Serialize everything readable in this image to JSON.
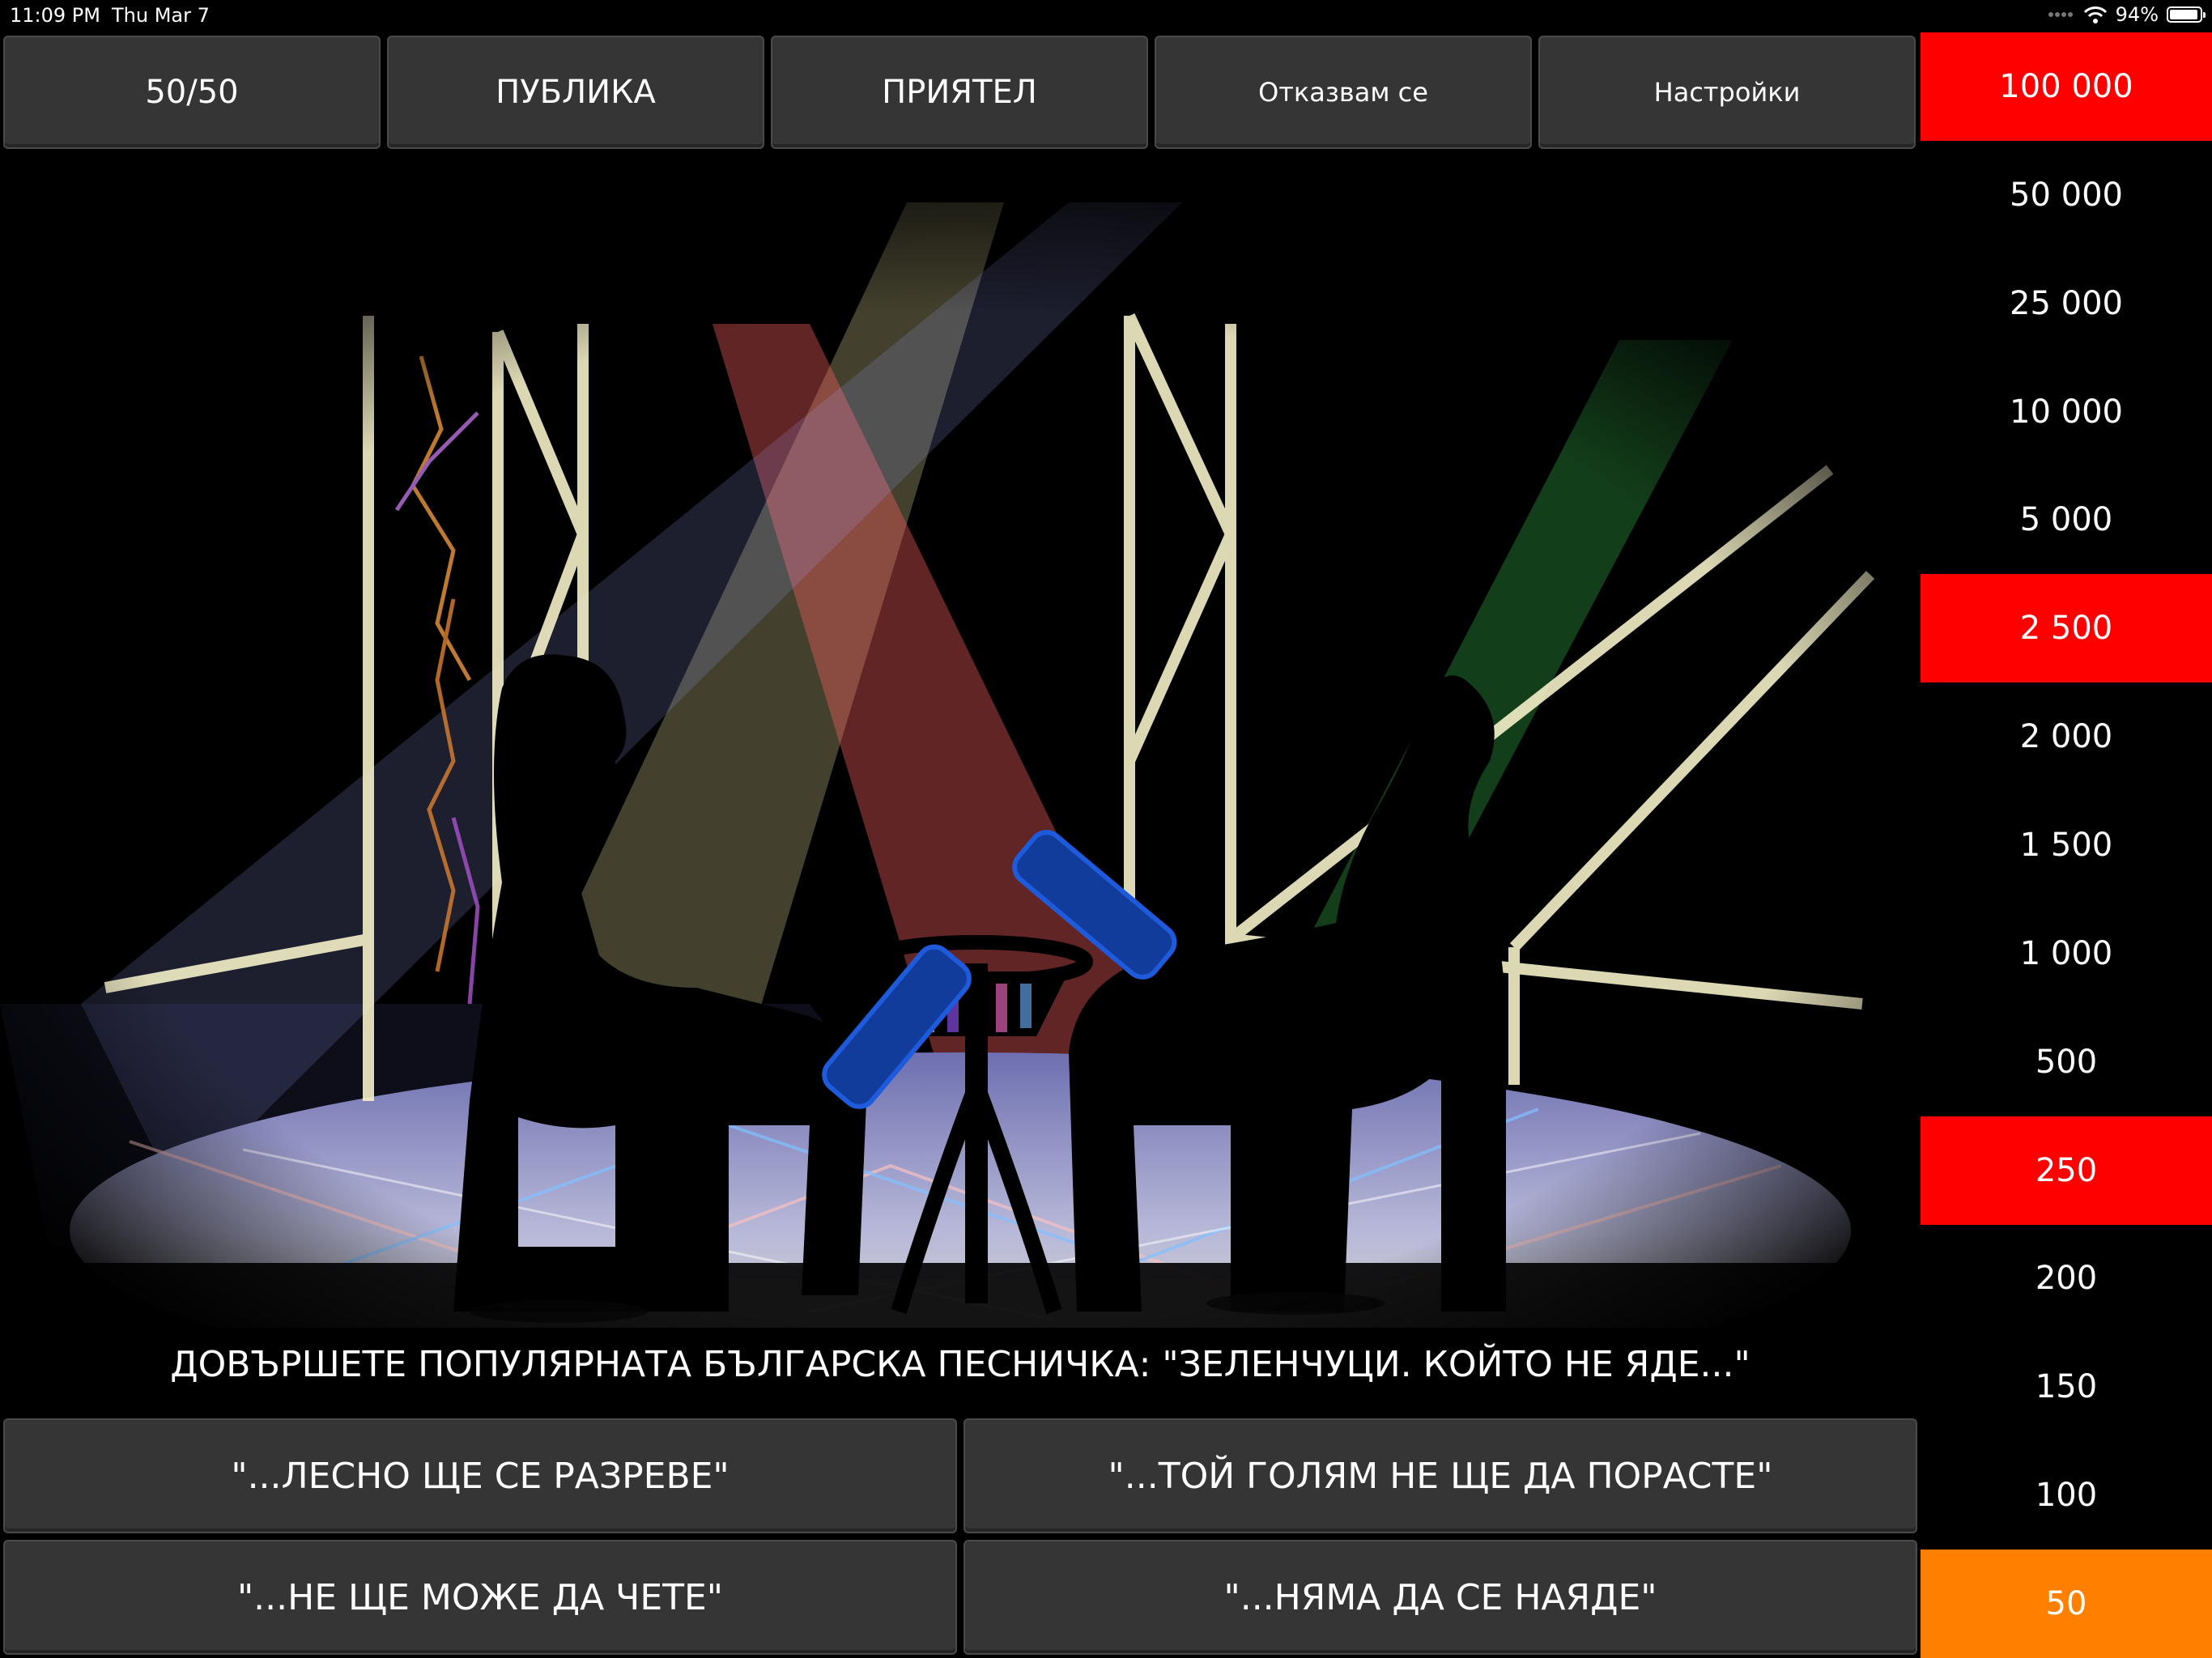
{
  "status_bar": {
    "time": "11:09 PM",
    "date": "Thu Mar 7",
    "battery": "94%"
  },
  "lifelines": {
    "fifty_fifty": "50/50",
    "audience": "ПУБЛИКА",
    "friend": "ПРИЯТЕЛ",
    "quit": "Отказвам се",
    "settings": "Настройки"
  },
  "question": "ДОВЪРШЕТЕ ПОПУЛЯРНАТА БЪЛГАРСКА ПЕСНИЧКА: \"ЗЕЛЕНЧУЦИ. КОЙТО НЕ ЯДЕ...\"",
  "answers": [
    "\"...ЛЕСНО ЩЕ СЕ РАЗРЕВЕ\"",
    "\"...ТОЙ ГОЛЯМ НЕ ЩЕ ДА ПОРАСТЕ\"",
    "\"...НЕ ЩЕ МОЖЕ ДА ЧЕТЕ\"",
    "\"...НЯМА ДА СЕ НАЯДЕ\""
  ],
  "prize_ladder": [
    {
      "amount": "100 000",
      "state": "safe"
    },
    {
      "amount": "50 000",
      "state": "normal"
    },
    {
      "amount": "25 000",
      "state": "normal"
    },
    {
      "amount": "10 000",
      "state": "normal"
    },
    {
      "amount": "5 000",
      "state": "normal"
    },
    {
      "amount": "2 500",
      "state": "safe"
    },
    {
      "amount": "2 000",
      "state": "normal"
    },
    {
      "amount": "1 500",
      "state": "normal"
    },
    {
      "amount": "1 000",
      "state": "normal"
    },
    {
      "amount": "500",
      "state": "normal"
    },
    {
      "amount": "250",
      "state": "safe"
    },
    {
      "amount": "200",
      "state": "normal"
    },
    {
      "amount": "150",
      "state": "normal"
    },
    {
      "amount": "100",
      "state": "normal"
    },
    {
      "amount": "50",
      "state": "current"
    }
  ],
  "colors": {
    "safe_level": "#ff0000",
    "current_level": "#ff8000",
    "button": "#353535"
  }
}
